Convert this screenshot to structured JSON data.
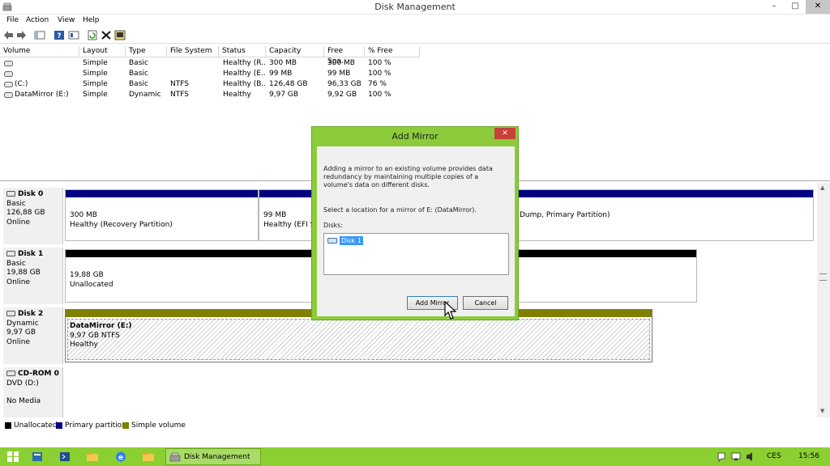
{
  "window": {
    "title": "Disk Management",
    "minimize": "–",
    "maximize": "□",
    "close": "✕"
  },
  "menu": [
    "File",
    "Action",
    "View",
    "Help"
  ],
  "toolbar": [
    "back-arrow-icon",
    "forward-arrow-icon",
    "console-icon",
    "help-icon",
    "properties-icon",
    "refresh-icon",
    "delete-icon",
    "settings-icon"
  ],
  "volumes": {
    "headers": [
      "Volume",
      "Layout",
      "Type",
      "File System",
      "Status",
      "Capacity",
      "Free Spa...",
      "% Free"
    ],
    "rows": [
      [
        "",
        "Simple",
        "Basic",
        "",
        "Healthy (R...",
        "300 MB",
        "300 MB",
        "100 %"
      ],
      [
        "",
        "Simple",
        "Basic",
        "",
        "Healthy (E...",
        "99 MB",
        "99 MB",
        "100 %"
      ],
      [
        "(C:)",
        "Simple",
        "Basic",
        "NTFS",
        "Healthy (B...",
        "126,48 GB",
        "96,33 GB",
        "76 %"
      ],
      [
        "DataMirror (E:)",
        "Simple",
        "Dynamic",
        "NTFS",
        "Healthy",
        "9,97 GB",
        "9,92 GB",
        "100 %"
      ]
    ]
  },
  "disks": [
    {
      "name": "Disk 0",
      "type": "Basic",
      "size": "126,88 GB",
      "status": "Online",
      "partitions": [
        {
          "line1": "300 MB",
          "line2": "Healthy (Recovery Partition)"
        },
        {
          "line1": "99 MB",
          "line2": "Healthy (EFI Sy"
        },
        {
          "line1": "",
          "line2": "Dump, Primary Partition)"
        }
      ]
    },
    {
      "name": "Disk 1",
      "type": "Basic",
      "size": "19,88 GB",
      "status": "Online",
      "partitions": [
        {
          "line1": "19,88 GB",
          "line2": "Unallocated"
        }
      ]
    },
    {
      "name": "Disk 2",
      "type": "Dynamic",
      "size": "9,97 GB",
      "status": "Online",
      "partitions": [
        {
          "line1": "DataMirror  (E:)",
          "line2": "9,97 GB NTFS",
          "line3": "Healthy"
        }
      ]
    },
    {
      "name": "CD-ROM 0",
      "type": "DVD (D:)",
      "size": "",
      "status": "No Media",
      "partitions": []
    }
  ],
  "legend": [
    {
      "label": "Unallocated",
      "color": "#000000"
    },
    {
      "label": "Primary partition",
      "color": "#000080"
    },
    {
      "label": "Simple volume",
      "color": "#808000"
    }
  ],
  "dialog": {
    "title": "Add Mirror",
    "close": "✕",
    "description": "Adding a mirror to an existing volume provides data redundancy by maintaining multiple copies of a volume's data on different disks.",
    "location_prompt": "Select a location for a mirror of E: (DataMirror).",
    "disks_label": "Disks:",
    "disks": [
      "Disk 1"
    ],
    "add_button": "Add Mirror",
    "cancel_button": "Cancel"
  },
  "taskbar": {
    "task": "Disk Management",
    "lang": "CES",
    "time": "15:56"
  },
  "colors": {
    "primary": "#000080",
    "simple": "#808000",
    "unallocated": "#000000",
    "taskbar": "#8ccf32",
    "dialog_frame": "#8ccc3b"
  }
}
